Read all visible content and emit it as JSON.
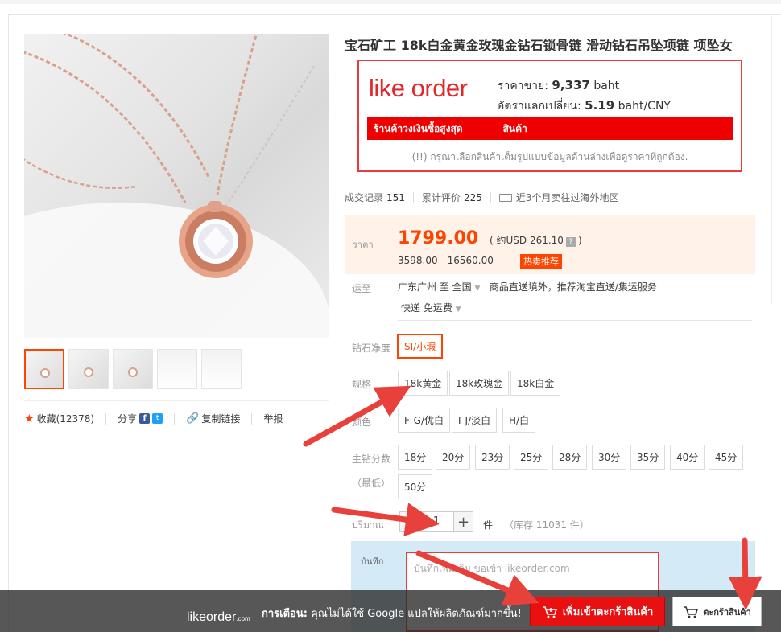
{
  "product": {
    "title": "宝石矿工 18k白金黄金玫瑰金钻石锁骨链 滑动钻石吊坠项链 项坠女"
  },
  "likeorder": {
    "logo": "like order",
    "price_label": "ราคาขาย:",
    "price_value": "9,337",
    "price_unit": "baht",
    "rate_label": "อัตราแลกเปลี่ยน:",
    "rate_value": "5.19",
    "rate_unit": "baht/CNY",
    "bar_left": "ร้านค้าวงเงินซื้อสูงสุด",
    "bar_right": "สินค้า",
    "note": "(!!) กรุณาเลือกสินค้าเต็มรูปแบบข้อมูลด้านล่างเพื่อดูราคาที่ถูกต้อง."
  },
  "stats": {
    "deals_label": "成交记录",
    "deals": "151",
    "reviews_label": "累计评价",
    "reviews": "225",
    "overseas": "近3个月卖往过海外地区"
  },
  "price": {
    "label": "ราคา",
    "current": "1799.00",
    "usd": "( 约USD 261.10",
    "usd_close": ")",
    "qmark": "?",
    "original": "3598.00 - 16560.00",
    "hot_tag": "热卖推荐"
  },
  "shipping": {
    "label": "运至",
    "from_to": "广东广州 至  全国",
    "service": "商品直送境外，推荐淘宝直送/集运服务",
    "method": "快递 免运费"
  },
  "options": {
    "clarity_label": "钻石净度",
    "clarity": [
      "SI/小瑕"
    ],
    "spec_label": "规格",
    "spec": [
      "18k黄金",
      "18k玫瑰金",
      "18k白金"
    ],
    "color_label": "颜色",
    "color": [
      "F-G/优白",
      "I-J/淡白",
      "H/白"
    ],
    "carat_label": "主钻分数",
    "carat_label2": "（最低）",
    "carat": [
      "18分",
      "20分",
      "23分",
      "25分",
      "28分",
      "30分",
      "35分",
      "40分",
      "45分",
      "50分"
    ]
  },
  "quantity": {
    "label": "ปริมาณ",
    "minus": "−",
    "value": "1",
    "plus": "+",
    "unit": "件",
    "stock": "（库存 11031 件）"
  },
  "note": {
    "label": "บันทึก",
    "placeholder": "บันทึกเพิ่มเติม ขอเข้า likeorder.com"
  },
  "social": {
    "favorite": "收藏(12378)",
    "share": "分享",
    "copy_link": "复制链接",
    "report": "举报"
  },
  "bottom": {
    "logo": "likeorder",
    "logo_suffix": ".com",
    "warning_bold": "การเตือน:",
    "warning": " คุณไม่ได้ใช้ Google แปลให้ผลิตภัณฑ์มากขึ้น!",
    "add_to_cart": "เพิ่มเข้าตะกร้าสินค้า",
    "cart": "ตะกร้าสินค้า"
  },
  "colors": {
    "accent": "#ff4400",
    "likeorder_red": "#e4262a",
    "arrow": "#e8403a"
  }
}
